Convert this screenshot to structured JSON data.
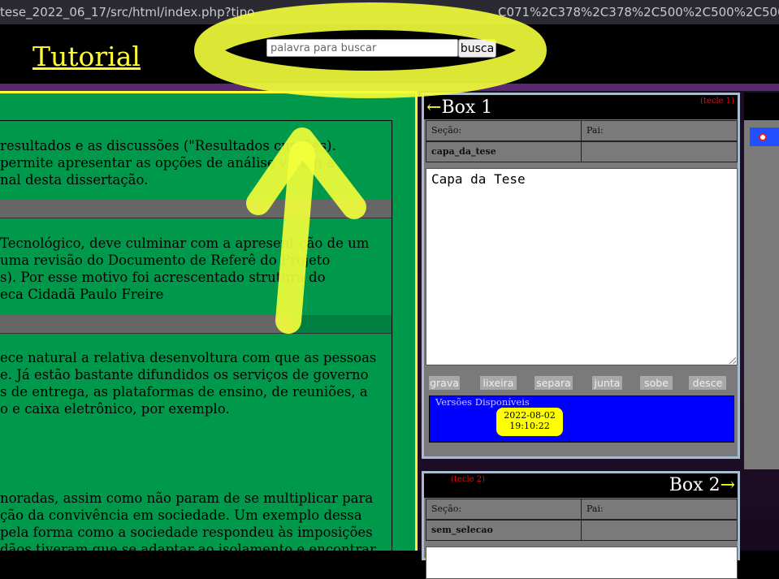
{
  "browser": {
    "url_left": "tese_2022_06_17/src/html/index.php?tipo",
    "url_right": "C071%2C378%2C378%2C500%2C500%2C500%"
  },
  "header": {
    "title": "Tutorial",
    "search_placeholder": "palavra para buscar",
    "search_button": "busca"
  },
  "document": {
    "para1": [
      "resultados e as discussões (\"Resultados   cussões).",
      "permite apresentar as opções de análise   varam à",
      "nal desta dissertação."
    ],
    "para2": [
      "Tecnológico, deve culminar com a apresent   ção de um",
      " uma revisão do Documento de Referê      do Projeto",
      "s). Por esse motivo foi acrescentado     strutura do",
      "eca Cidadã Paulo Freire"
    ],
    "para3": [
      "ece natural a relativa desenvoltura com que as pessoas",
      "e. Já estão bastante difundidos os serviços de governo",
      "s de entrega, as plataformas de ensino, de reuniões, a",
      "o e caixa eletrônico, por exemplo."
    ],
    "para4": [
      "noradas, assim como não param de se multiplicar para",
      "ção da convivência em sociedade. Um exemplo dessa",
      " pela forma como a sociedade respondeu às imposições",
      "dãos tiveram que se adaptar ao isolamento e encontrar"
    ]
  },
  "box1": {
    "title": "Box 1",
    "arrow": "←",
    "hint": "(tecle 1)",
    "secao_label": "Seção:",
    "pai_label": "Pai:",
    "secao_value": "capa_da_tese",
    "pai_value": "",
    "content": "Capa da Tese",
    "buttons": [
      "grava",
      "lixeira",
      "separa",
      "junta",
      "sobe",
      "desce"
    ],
    "versions_label": "Versões Disponíveis",
    "version_date": "2022-08-02",
    "version_time": "19:10:22"
  },
  "box2": {
    "title": "Box 2",
    "arrow": "→",
    "hint": "(tecle 2)",
    "secao_label": "Seção:",
    "pai_label": "Pai:",
    "secao_value": "sem_selecao",
    "pai_value": ""
  },
  "colors": {
    "highlight": "#f4ff3a",
    "page_title": "#ffff33",
    "doc_bg": "#00994c",
    "versions_bg": "#0000ff",
    "version_badge": "#ffff00"
  }
}
